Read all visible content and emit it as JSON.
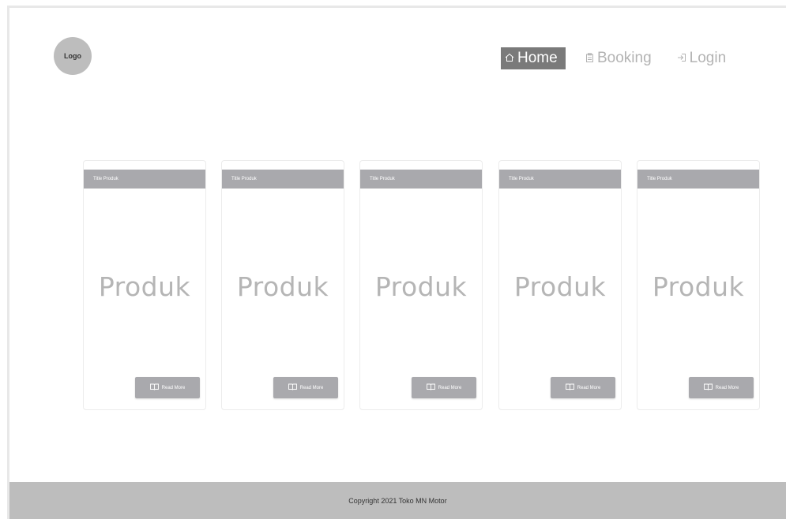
{
  "header": {
    "logo_text": "Logo"
  },
  "nav": {
    "items": [
      {
        "label": "Home",
        "icon": "home-icon",
        "active": true
      },
      {
        "label": "Booking",
        "icon": "clipboard-icon",
        "active": false
      },
      {
        "label": "Login",
        "icon": "login-icon",
        "active": false
      }
    ]
  },
  "products": [
    {
      "title": "Title Produk",
      "body": "Produk",
      "button": "Read More"
    },
    {
      "title": "Title Produk",
      "body": "Produk",
      "button": "Read More"
    },
    {
      "title": "Title Produk",
      "body": "Produk",
      "button": "Read More"
    },
    {
      "title": "Title Produk",
      "body": "Produk",
      "button": "Read More"
    },
    {
      "title": "Title Produk",
      "body": "Produk",
      "button": "Read More"
    }
  ],
  "footer": {
    "text": "Copyright 2021 Toko MN Motor"
  },
  "colors": {
    "accent_gray": "#a9a9ad",
    "nav_active": "#7a7a7a",
    "footer_bg": "#bdbdbd"
  }
}
